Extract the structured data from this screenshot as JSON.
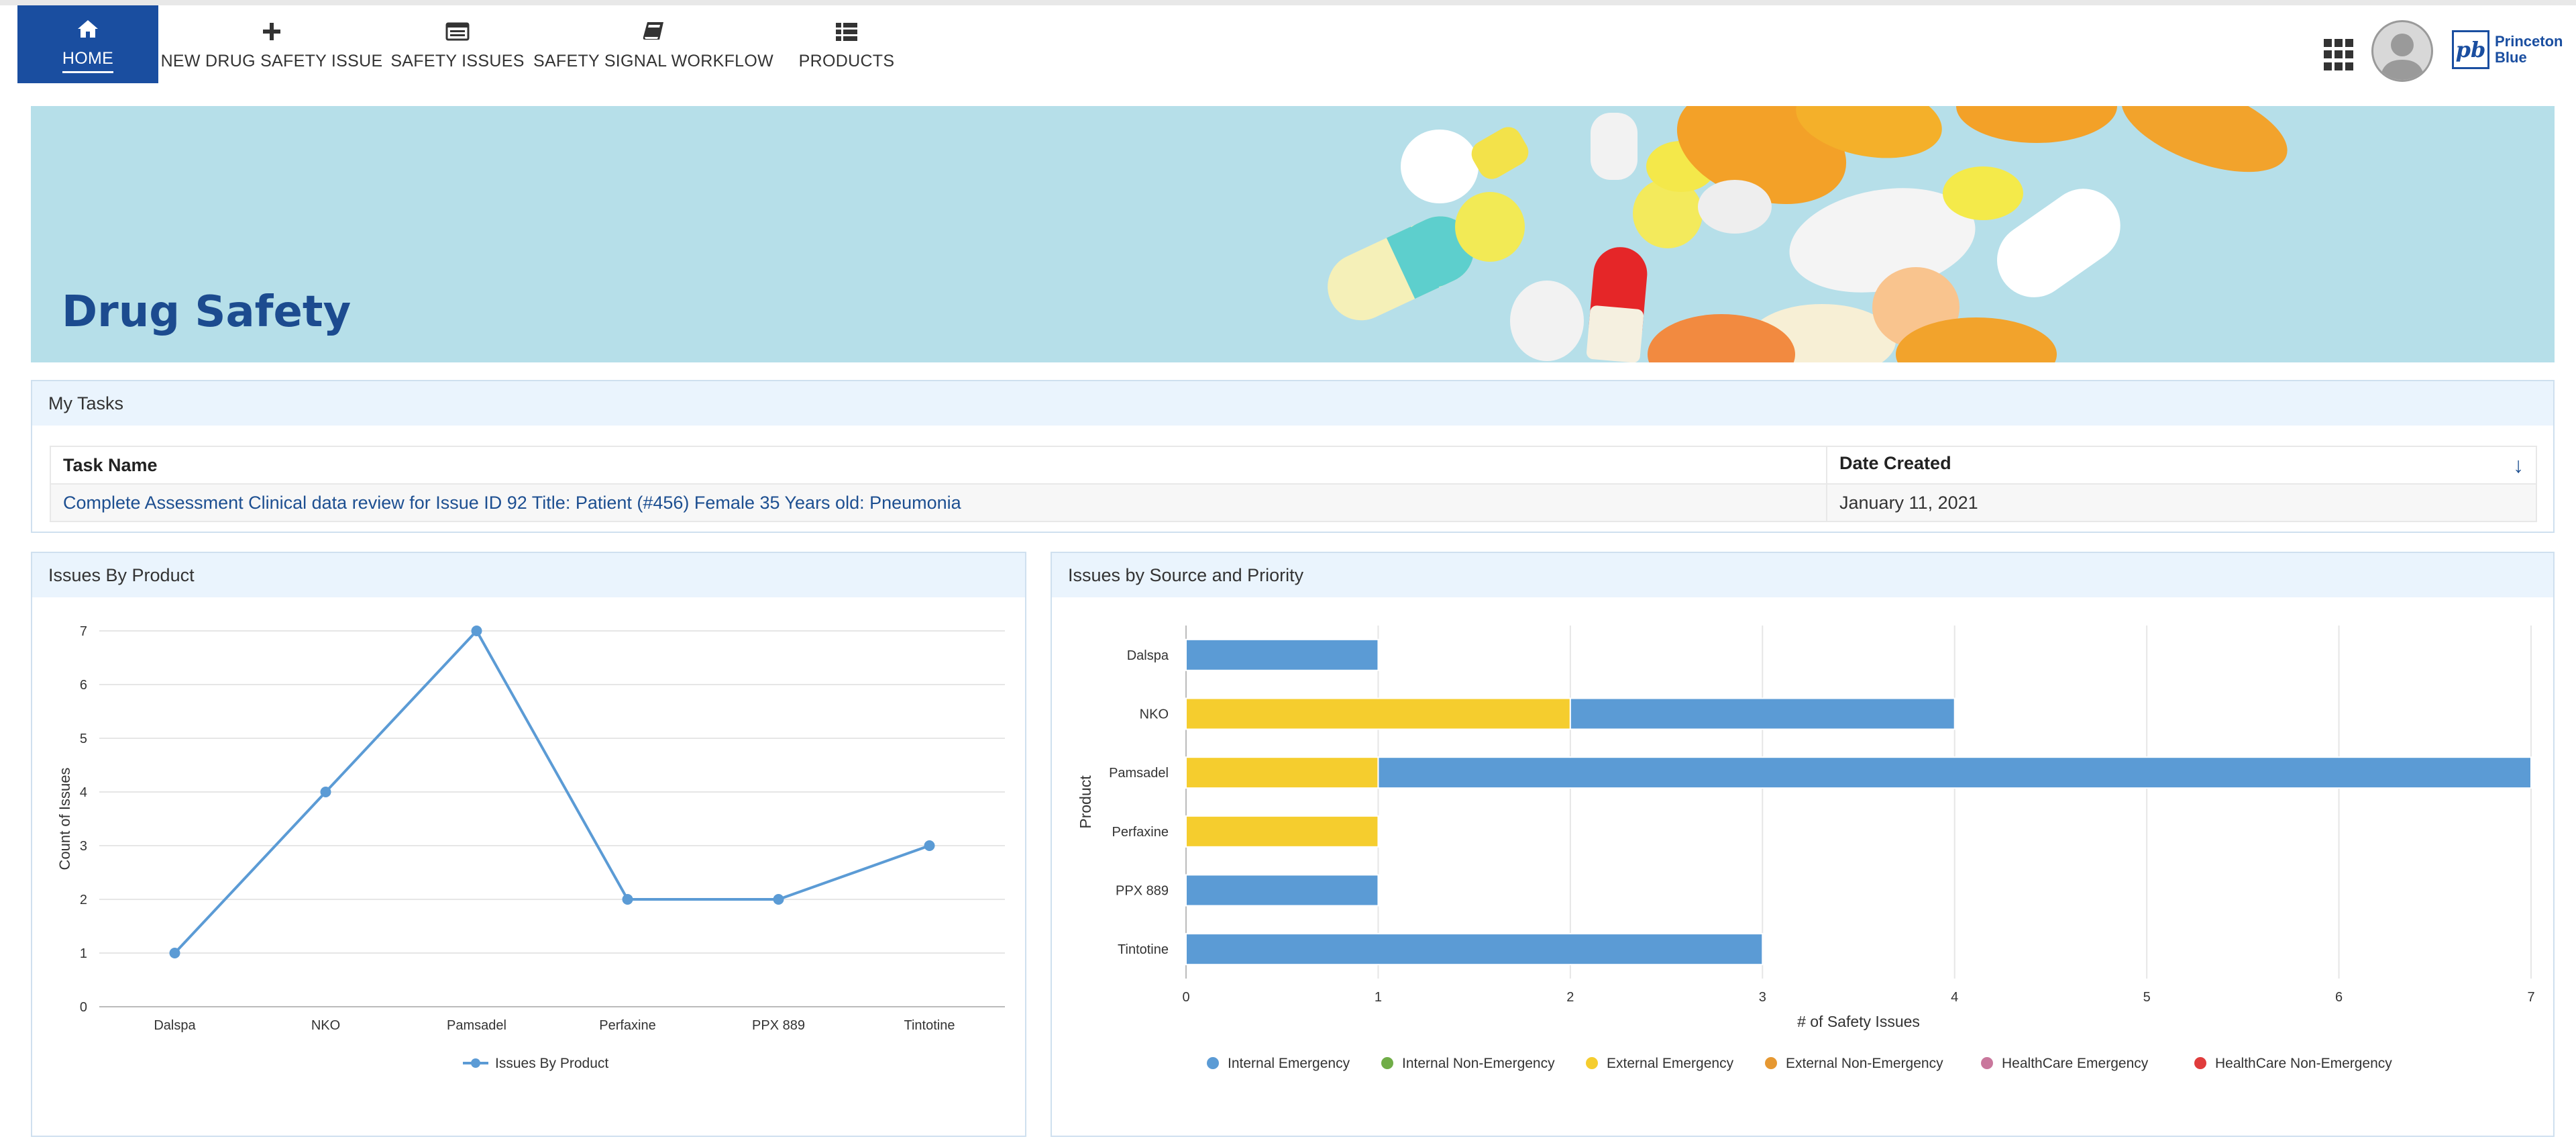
{
  "nav": {
    "items": [
      {
        "label": "HOME",
        "icon": "home-icon"
      },
      {
        "label": "NEW DRUG SAFETY ISSUE",
        "icon": "plus-icon"
      },
      {
        "label": "SAFETY ISSUES",
        "icon": "list-card-icon"
      },
      {
        "label": "SAFETY SIGNAL WORKFLOW",
        "icon": "book-icon"
      },
      {
        "label": "PRODUCTS",
        "icon": "table-list-icon"
      }
    ],
    "active": "HOME",
    "accent": "#1a4ea0"
  },
  "logo": {
    "line1": "Princeton",
    "line2": "Blue",
    "mark": "pb"
  },
  "banner": {
    "title": "Drug Safety"
  },
  "tasks": {
    "title": "My Tasks",
    "columns": [
      "Task Name",
      "Date Created"
    ],
    "rows": [
      [
        "Complete Assessment Clinical data review for Issue ID 92 Title: Patient (#456) Female 35 Years old: Pneumonia",
        "January 11, 2021"
      ]
    ],
    "sort_icon": "sort-down-arrow-icon"
  },
  "panels": {
    "product_title": "Issues By Product",
    "source_title": "Issues by Source and Priority"
  },
  "chart_data": [
    {
      "type": "line",
      "categories": [
        "Dalspa",
        "NKO",
        "Pamsadel",
        "Perfaxine",
        "PPX 889",
        "Tintotine"
      ],
      "series": [
        {
          "name": "Issues By Product",
          "values": [
            1,
            4,
            7,
            2,
            2,
            3
          ],
          "color": "#5b9bd5"
        }
      ],
      "ylabel": "Count of Issues",
      "xlabel": "",
      "ylim": [
        0,
        7
      ],
      "yticks": [
        "0",
        "1",
        "2",
        "3",
        "4",
        "5",
        "6",
        "7"
      ],
      "grid": true,
      "legend": "bottom-center"
    },
    {
      "type": "bar",
      "orientation": "horizontal",
      "stacked": true,
      "categories": [
        "Dalspa",
        "NKO",
        "Pamsadel",
        "Perfaxine",
        "PPX 889",
        "Tintotine"
      ],
      "series": [
        {
          "name": "Internal Emergency",
          "color": "#5b9bd5",
          "values": [
            1,
            2,
            6,
            0,
            1,
            3
          ]
        },
        {
          "name": "Internal Non-Emergency",
          "color": "#70ad47",
          "values": [
            0,
            0,
            0,
            0,
            0,
            0
          ]
        },
        {
          "name": "External Emergency",
          "color": "#f5cd2e",
          "values": [
            0,
            2,
            1,
            1,
            0,
            0
          ]
        },
        {
          "name": "External Non-Emergency",
          "color": "#e69832",
          "values": [
            0,
            0,
            0,
            0,
            0,
            0
          ]
        },
        {
          "name": "HealthCare Emergency",
          "color": "#c9779c",
          "values": [
            0,
            0,
            0,
            0,
            0,
            0
          ]
        },
        {
          "name": "HealthCare Non-Emergency",
          "color": "#e03c3c",
          "values": [
            0,
            0,
            0,
            0,
            0,
            0
          ]
        }
      ],
      "stack_order": [
        "External Emergency",
        "Internal Emergency"
      ],
      "xlabel": "# of Safety Issues",
      "ylabel": "Product",
      "xlim": [
        0,
        7
      ],
      "xticks": [
        "0",
        "1",
        "2",
        "3",
        "4",
        "5",
        "6",
        "7"
      ],
      "grid": true,
      "legend": "bottom-center"
    }
  ]
}
